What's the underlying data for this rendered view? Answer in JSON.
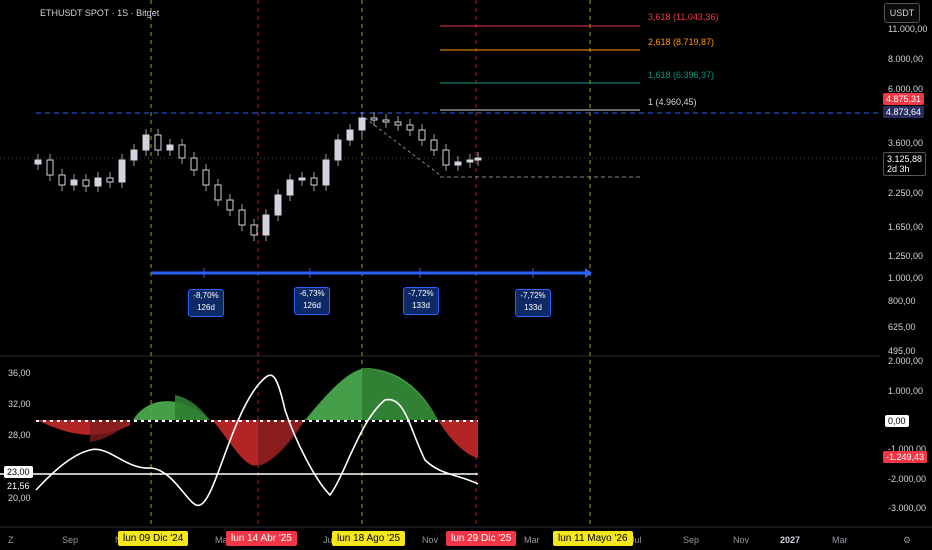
{
  "header": {
    "symbol_title": "ETHUSDT SPOT · 1S · Bitget",
    "currency": "USDT"
  },
  "price_axis": {
    "ticks": [
      "11.000,00",
      "8.000,00",
      "6.000,00",
      "3.600,00",
      "2.250,00",
      "1.650,00",
      "1.250,00",
      "1.000,00",
      "800,00",
      "625,00",
      "495,00"
    ],
    "level_high_1": "4.875,31",
    "level_high_2": "4.873,64",
    "current_price": "3.125,88",
    "countdown": "2d 3h"
  },
  "oscillator_axis": {
    "right_ticks": [
      "2.000,00",
      "1.000,00",
      "-1.000,00",
      "-2.000,00",
      "-3.000,00"
    ],
    "left_ticks": [
      "36,00",
      "32,00",
      "28,00",
      "20,00"
    ],
    "zero_tag": "0,00",
    "neg_tag": "-1.249,43",
    "left_tag_1": "23,00",
    "left_tag_2": "21,56"
  },
  "fib_levels": [
    {
      "label": "3,618 (11.043,36)",
      "color": "#f23645"
    },
    {
      "label": "2,618 (8.719,87)",
      "color": "#ff9800"
    },
    {
      "label": "1,618 (6.396,37)",
      "color": "#089981"
    },
    {
      "label": "1 (4.960,45)",
      "color": "#d1d4dc"
    }
  ],
  "periods": [
    {
      "pct": "-8,70%",
      "days": "126d"
    },
    {
      "pct": "-6,73%",
      "days": "126d"
    },
    {
      "pct": "-7,72%",
      "days": "133d"
    },
    {
      "pct": "-7,72%",
      "days": "133d"
    }
  ],
  "time_axis": {
    "months": [
      "Sep",
      "N",
      "Ma",
      "Ju",
      "Nov",
      "Mar",
      "Jul",
      "Sep",
      "Nov",
      "2027",
      "Mar"
    ],
    "date_tags": [
      {
        "label": "lun 09 Dic '24",
        "bg": "#f5e61e",
        "fg": "#000"
      },
      {
        "label": "lun 14 Abr '25",
        "bg": "#f23645",
        "fg": "#fff"
      },
      {
        "label": "lun 18 Ago '25",
        "bg": "#f5e61e",
        "fg": "#000"
      },
      {
        "label": "lun 29 Dic '25",
        "bg": "#f23645",
        "fg": "#fff"
      },
      {
        "label": "lun 11 Mayo '26",
        "bg": "#f5e61e",
        "fg": "#000"
      }
    ]
  },
  "colors": {
    "up": "#089981",
    "down": "#f23645",
    "accent": "#2962ff",
    "osc_green": "#4caf50",
    "osc_red": "#c62828"
  }
}
